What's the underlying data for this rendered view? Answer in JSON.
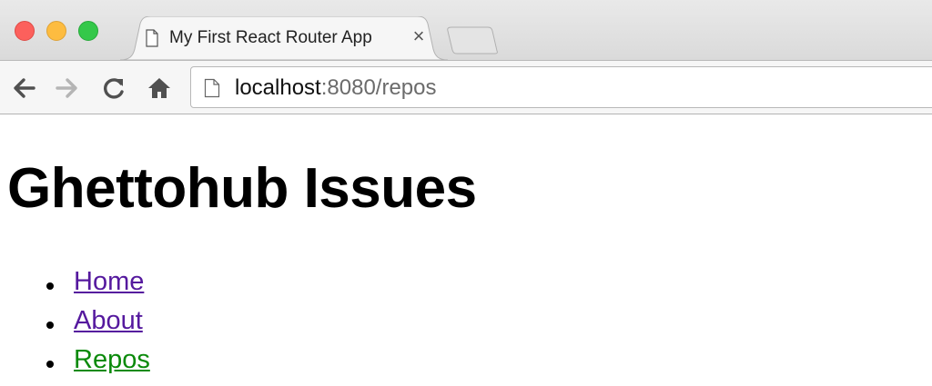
{
  "browser": {
    "window_controls": [
      "close",
      "minimize",
      "zoom"
    ],
    "tab": {
      "title": "My First React Router App",
      "close_glyph": "×",
      "icon": "page-icon"
    },
    "toolbar": {
      "back_icon": "back-arrow-icon",
      "forward_icon": "forward-arrow-icon",
      "reload_icon": "reload-icon",
      "home_icon": "home-icon"
    },
    "address_bar": {
      "host": "localhost",
      "rest": ":8080/repos"
    }
  },
  "page": {
    "title": "Ghettohub Issues",
    "nav_links": [
      {
        "label": "Home",
        "state": "visited",
        "color": "#55199e"
      },
      {
        "label": "About",
        "state": "visited",
        "color": "#55199e"
      },
      {
        "label": "Repos",
        "state": "active",
        "color": "#0a8a0a"
      }
    ]
  }
}
